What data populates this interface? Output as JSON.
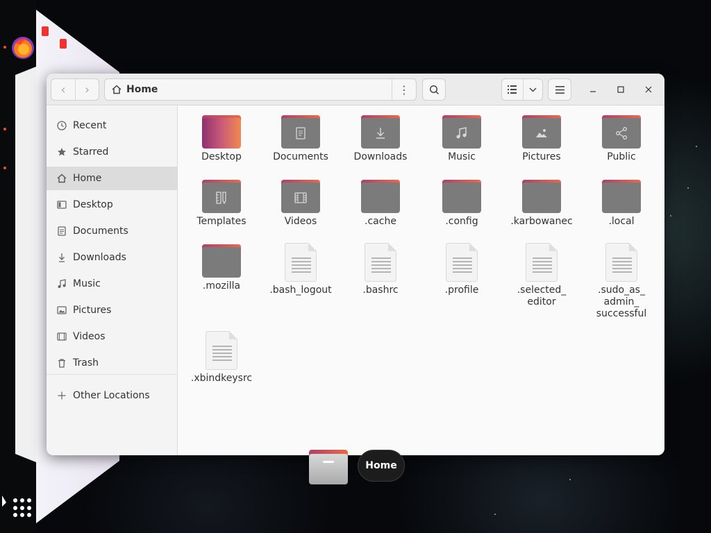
{
  "window": {
    "title": "Home",
    "nav_back": "‹",
    "nav_forward": "›"
  },
  "sidebar": {
    "items": [
      {
        "label": "Recent",
        "icon": "clock-icon"
      },
      {
        "label": "Starred",
        "icon": "star-icon"
      },
      {
        "label": "Home",
        "icon": "home-icon",
        "active": true
      },
      {
        "label": "Desktop",
        "icon": "desktop-icon"
      },
      {
        "label": "Documents",
        "icon": "documents-icon"
      },
      {
        "label": "Downloads",
        "icon": "downloads-icon"
      },
      {
        "label": "Music",
        "icon": "music-icon"
      },
      {
        "label": "Pictures",
        "icon": "pictures-icon"
      },
      {
        "label": "Videos",
        "icon": "videos-icon"
      },
      {
        "label": "Trash",
        "icon": "trash-icon"
      }
    ],
    "other_locations": "Other Locations"
  },
  "files": [
    {
      "label": "Desktop",
      "type": "folder-desktop"
    },
    {
      "label": "Documents",
      "type": "folder",
      "icon": "document-icon"
    },
    {
      "label": "Downloads",
      "type": "folder",
      "icon": "download-icon"
    },
    {
      "label": "Music",
      "type": "folder",
      "icon": "music-icon"
    },
    {
      "label": "Pictures",
      "type": "folder",
      "icon": "picture-icon"
    },
    {
      "label": "Public",
      "type": "folder",
      "icon": "share-icon"
    },
    {
      "label": "Templates",
      "type": "folder",
      "icon": "template-icon"
    },
    {
      "label": "Videos",
      "type": "folder",
      "icon": "film-icon"
    },
    {
      "label": ".cache",
      "type": "folder"
    },
    {
      "label": ".config",
      "type": "folder"
    },
    {
      "label": ".karbowanec",
      "type": "folder"
    },
    {
      "label": ".local",
      "type": "folder"
    },
    {
      "label": ".mozilla",
      "type": "folder"
    },
    {
      "label": ".bash_logout",
      "type": "file"
    },
    {
      "label": ".bashrc",
      "type": "file"
    },
    {
      "label": ".profile",
      "type": "file"
    },
    {
      "label": ".selected_\neditor",
      "type": "file"
    },
    {
      "label": ".sudo_as_\nadmin_\nsuccessful",
      "type": "file"
    },
    {
      "label": ".xbindkeysrc",
      "type": "file"
    }
  ],
  "tooltip": {
    "label": "Home"
  },
  "colors": {
    "accent": "#e95420",
    "folder_tab": "#c64e5a",
    "folder_body": "#7b7b7b"
  }
}
